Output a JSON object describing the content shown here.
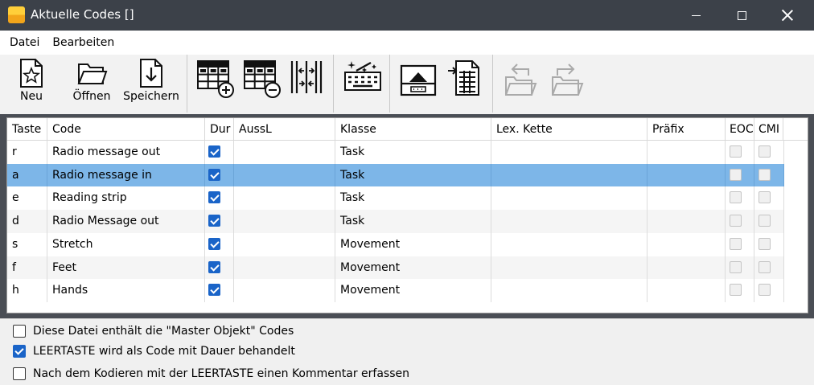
{
  "window": {
    "title": "Aktuelle Codes []",
    "app_icon": "mangold-app-icon"
  },
  "menu": [
    "Datei",
    "Bearbeiten"
  ],
  "toolbar": {
    "new_label": "Neu",
    "open_label": "Öffnen",
    "save_label": "Speichern"
  },
  "columns": [
    "Taste",
    "Code",
    "Dur",
    "AussL",
    "Klasse",
    "Lex. Kette",
    "Präfix",
    "EOC",
    "CMI"
  ],
  "rows": [
    {
      "key": "r",
      "code": "Radio message out",
      "dur": true,
      "aussl": "",
      "klasse": "Task",
      "lex": "",
      "praefix": "",
      "eoc": false,
      "cmi": false
    },
    {
      "key": "a",
      "code": "Radio message in",
      "dur": true,
      "aussl": "",
      "klasse": "Task",
      "lex": "",
      "praefix": "",
      "eoc": false,
      "cmi": false
    },
    {
      "key": "e",
      "code": "Reading strip",
      "dur": true,
      "aussl": "",
      "klasse": "Task",
      "lex": "",
      "praefix": "",
      "eoc": false,
      "cmi": false
    },
    {
      "key": "d",
      "code": "Radio Message out",
      "dur": true,
      "aussl": "",
      "klasse": "Task",
      "lex": "",
      "praefix": "",
      "eoc": false,
      "cmi": false
    },
    {
      "key": "s",
      "code": "Stretch",
      "dur": true,
      "aussl": "",
      "klasse": "Movement",
      "lex": "",
      "praefix": "",
      "eoc": false,
      "cmi": false
    },
    {
      "key": "f",
      "code": "Feet",
      "dur": true,
      "aussl": "",
      "klasse": "Movement",
      "lex": "",
      "praefix": "",
      "eoc": false,
      "cmi": false
    },
    {
      "key": "h",
      "code": "Hands",
      "dur": true,
      "aussl": "",
      "klasse": "Movement",
      "lex": "",
      "praefix": "",
      "eoc": false,
      "cmi": false
    }
  ],
  "selected_row": 1,
  "options": [
    {
      "label": "Diese Datei enthält die \"Master Objekt\" Codes",
      "checked": false
    },
    {
      "label": "LEERTASTE wird als Code mit Dauer behandelt",
      "checked": true
    },
    {
      "label": "Nach dem Kodieren mit der LEERTASTE einen Kommentar erfassen",
      "checked": false
    }
  ],
  "colors": {
    "titlebar": "#3c4149",
    "selection": "#7db6e8",
    "checkbox_accent": "#1a64c8"
  }
}
